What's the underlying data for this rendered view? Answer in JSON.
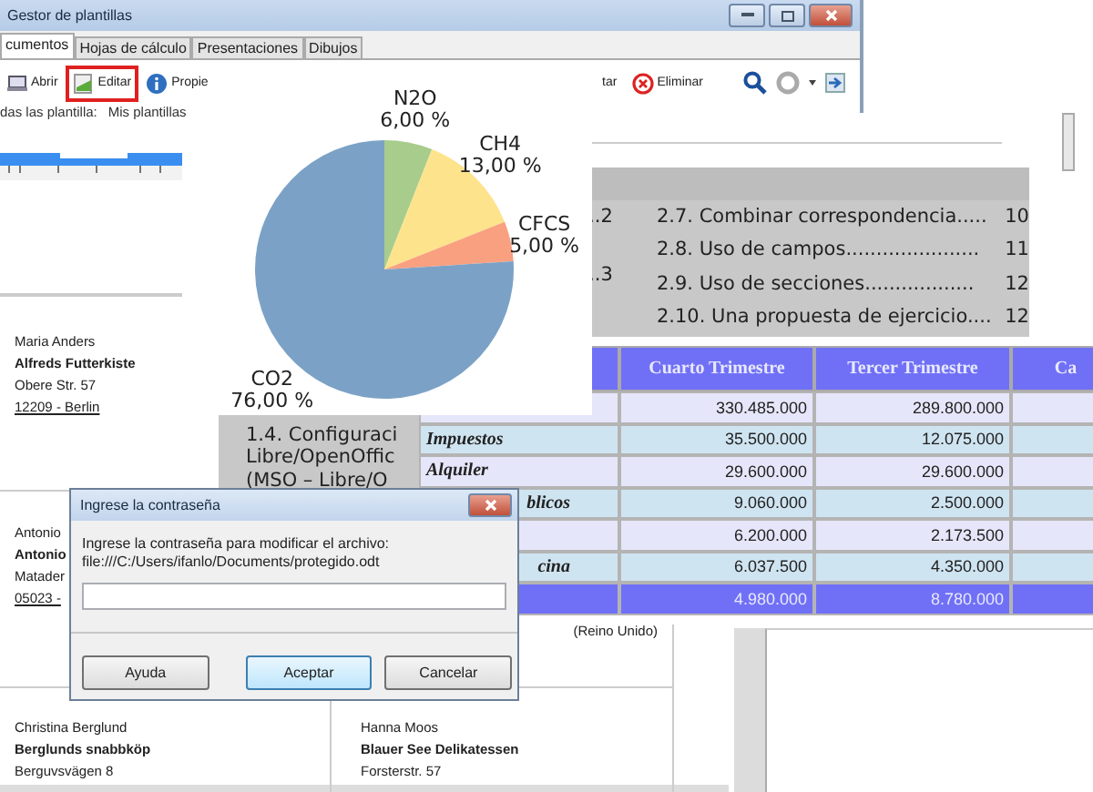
{
  "template_manager": {
    "title": "Gestor de plantillas",
    "tabs": [
      {
        "label": "cumentos",
        "selected": true
      },
      {
        "label": "Hojas de cálculo",
        "selected": false
      },
      {
        "label": "Presentaciones",
        "selected": false
      },
      {
        "label": "Dibujos",
        "selected": false
      }
    ],
    "toolbar": [
      {
        "label": "Abrir",
        "kind": "open",
        "highlighted": false
      },
      {
        "label": "Editar",
        "kind": "edit",
        "highlighted": true
      },
      {
        "label": "Propie",
        "kind": "info",
        "highlighted": false
      }
    ],
    "toolbar_right": [
      {
        "label": "tar",
        "kind": "plain",
        "highlighted": false
      },
      {
        "label": "Eliminar",
        "kind": "delete",
        "highlighted": false
      }
    ],
    "filters": [
      "das las plantilla:",
      "Mis plantillas"
    ]
  },
  "address_labels": [
    {
      "lines": [
        "Maria Anders",
        "Alfreds Futterkiste",
        "Obere Str. 57",
        "12209 - Berlin"
      ]
    },
    {
      "lines": [
        "Antonio",
        "Antonio",
        "Matader",
        "05023 -"
      ]
    },
    {
      "lines": [
        "(Reino Unido)"
      ]
    },
    {
      "lines": [
        "Christina Berglund",
        "Berglunds snabbköp",
        "Berguvsvägen 8"
      ]
    },
    {
      "lines": [
        "Hanna Moos",
        "Blauer See Delikatessen",
        "Forsterstr. 57"
      ]
    }
  ],
  "toc": {
    "left": [
      {
        "text": "..2"
      },
      {
        "text": "..3"
      },
      {
        "text": "1.4. Configuraci\nLibre/OpenOffic\n(MSO – Libre/O"
      }
    ],
    "entries": [
      {
        "text": "2.7. Combinar correspondencia.....",
        "page": "10"
      },
      {
        "text": "2.8. Uso de campos......................",
        "page": "11"
      },
      {
        "text": "2.9. Uso de secciones..................",
        "page": "12"
      },
      {
        "text": "2.10. Una propuesta de ejercicio....",
        "page": "12"
      }
    ]
  },
  "chart": {
    "chart_data": {
      "type": "pie",
      "categories": [
        "N2O",
        "CH4",
        "CFCS",
        "CO2"
      ],
      "values": [
        6,
        13,
        5,
        76
      ],
      "value_labels": [
        "6,00 %",
        "13,00 %",
        "5,00 %",
        "76,00 %"
      ],
      "colors": [
        "#a8cc8c",
        "#fde38c",
        "#f9a080",
        "#7ba2c6"
      ]
    }
  },
  "spreadsheet": {
    "columns": [
      "Cuarto Trimestre",
      "Tercer Trimestre",
      "Ca"
    ],
    "rows": [
      {
        "kind": "data",
        "values": [
          "330.485.000",
          "289.800.000"
        ]
      },
      {
        "kind": "data",
        "label": "Impuestos",
        "values": [
          "35.500.000",
          "12.075.000"
        ]
      },
      {
        "kind": "data",
        "label": "Alquiler",
        "values": [
          "29.600.000",
          "29.600.000"
        ]
      },
      {
        "kind": "data",
        "label": "blicos",
        "partly_hidden": true,
        "values": [
          "9.060.000",
          "2.500.000"
        ]
      },
      {
        "kind": "data",
        "values": [
          "6.200.000",
          "2.173.500"
        ]
      },
      {
        "kind": "data",
        "label": "cina",
        "partly_hidden": true,
        "values": [
          "6.037.500",
          "4.350.000"
        ]
      },
      {
        "kind": "total",
        "values": [
          "4.980.000",
          "8.780.000"
        ]
      }
    ]
  },
  "dialog": {
    "title": "Ingrese la contraseña",
    "message": "Ingrese la contraseña para modificar el archivo:",
    "path": "file:///C:/Users/ifanlo/Documents/protegido.odt",
    "buttons": [
      {
        "label": "Ayuda",
        "default": false
      },
      {
        "label": "Aceptar",
        "default": true
      },
      {
        "label": "Cancelar",
        "default": false
      }
    ]
  }
}
